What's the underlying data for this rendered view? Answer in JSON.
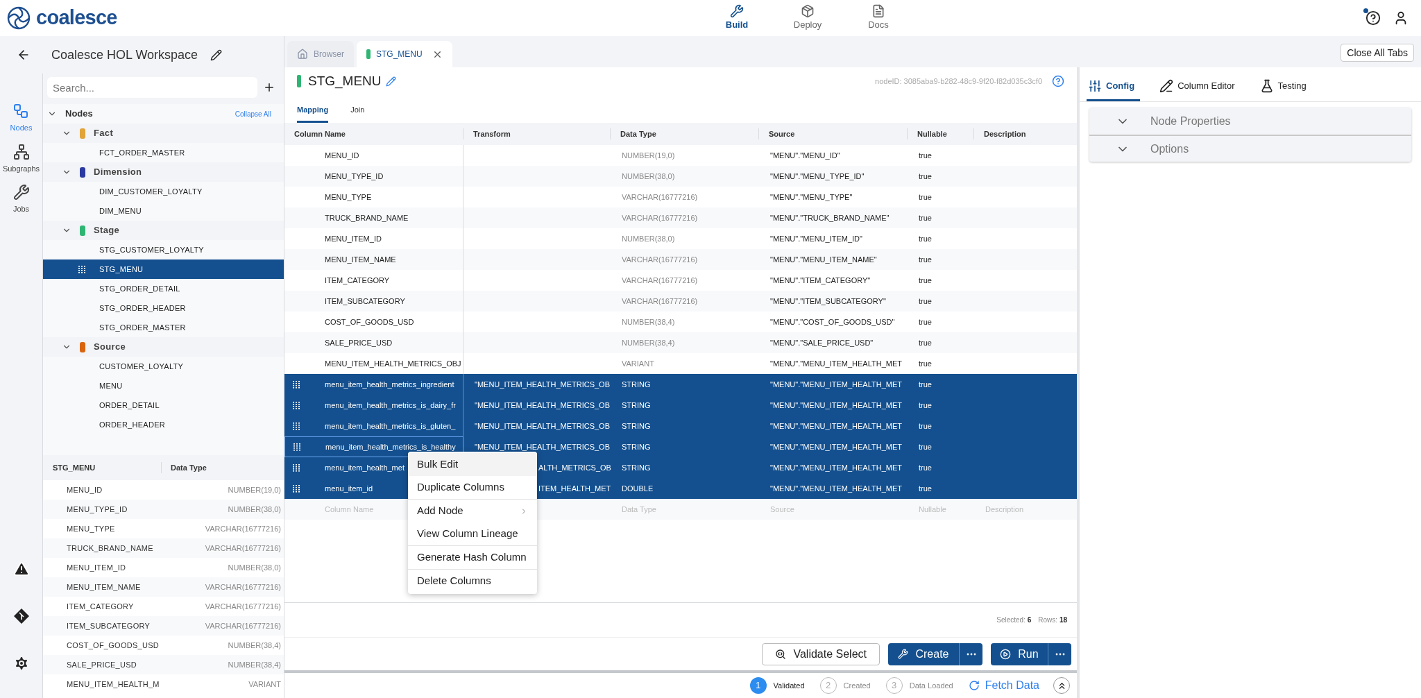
{
  "app": {
    "logo_text": "coalesce",
    "nav": [
      {
        "label": "Build",
        "kind": "build",
        "selected": true
      },
      {
        "label": "Deploy",
        "kind": "deploy",
        "selected": false
      },
      {
        "label": "Docs",
        "kind": "docs",
        "selected": false
      }
    ],
    "help_badge": true
  },
  "workspace": {
    "title": "Coalesce HOL Workspace"
  },
  "rail": [
    {
      "label": "Nodes",
      "kind": "nodes",
      "selected": true
    },
    {
      "label": "Subgraphs",
      "kind": "subgraphs",
      "selected": false
    },
    {
      "label": "Jobs",
      "kind": "jobs",
      "selected": false
    }
  ],
  "tree": {
    "search_placeholder": "Search...",
    "root": "Nodes",
    "root_expanded": true,
    "collapse_all": "Collapse All",
    "groups": [
      {
        "label": "Fact",
        "color": "#e0a43a",
        "expanded": true,
        "children": [
          {
            "label": "FCT_ORDER_MASTER",
            "selected": false
          }
        ]
      },
      {
        "label": "Dimension",
        "color": "#2b3aa0",
        "expanded": true,
        "children": [
          {
            "label": "DIM_CUSTOMER_LOYALTY",
            "selected": false
          },
          {
            "label": "DIM_MENU",
            "selected": false
          }
        ]
      },
      {
        "label": "Stage",
        "color": "#2fb573",
        "expanded": true,
        "children": [
          {
            "label": "STG_CUSTOMER_LOYALTY",
            "selected": false
          },
          {
            "label": "STG_MENU",
            "selected": true
          },
          {
            "label": "STG_ORDER_DETAIL",
            "selected": false
          },
          {
            "label": "STG_ORDER_HEADER",
            "selected": false
          },
          {
            "label": "STG_ORDER_MASTER",
            "selected": false
          }
        ]
      },
      {
        "label": "Source",
        "color": "#d9640f",
        "expanded": true,
        "children": [
          {
            "label": "CUSTOMER_LOYALTY",
            "selected": false
          },
          {
            "label": "MENU",
            "selected": false
          },
          {
            "label": "ORDER_DETAIL",
            "selected": false
          },
          {
            "label": "ORDER_HEADER",
            "selected": false
          }
        ]
      }
    ]
  },
  "column_list": {
    "columns": [
      "STG_MENU",
      "Data Type"
    ],
    "rows": [
      {
        "name": "MENU_ID",
        "type": "NUMBER(19,0)"
      },
      {
        "name": "MENU_TYPE_ID",
        "type": "NUMBER(38,0)"
      },
      {
        "name": "MENU_TYPE",
        "type": "VARCHAR(16777216)"
      },
      {
        "name": "TRUCK_BRAND_NAME",
        "type": "VARCHAR(16777216)"
      },
      {
        "name": "MENU_ITEM_ID",
        "type": "NUMBER(38,0)"
      },
      {
        "name": "MENU_ITEM_NAME",
        "type": "VARCHAR(16777216)"
      },
      {
        "name": "ITEM_CATEGORY",
        "type": "VARCHAR(16777216)"
      },
      {
        "name": "ITEM_SUBCATEGORY",
        "type": "VARCHAR(16777216)"
      },
      {
        "name": "COST_OF_GOODS_USD",
        "type": "NUMBER(38,4)"
      },
      {
        "name": "SALE_PRICE_USD",
        "type": "NUMBER(38,4)"
      },
      {
        "name": "MENU_ITEM_HEALTH_M",
        "type": "VARIANT"
      }
    ]
  },
  "tabs": [
    {
      "label": "Browser",
      "kind": "home",
      "selected": false
    },
    {
      "label": "STG_MENU",
      "kind": "node",
      "color": "#2fb573",
      "selected": true
    }
  ],
  "close_all": "Close All Tabs",
  "node": {
    "title": "STG_MENU",
    "color": "#2fb573",
    "node_id": "nodeID: 3085aba9-b282-48c9-9f20-f82d035c3cf0",
    "subtabs": [
      {
        "label": "Mapping",
        "selected": true
      },
      {
        "label": "Join",
        "selected": false
      }
    ],
    "table": {
      "columns": [
        "Column Name",
        "Transform",
        "Data Type",
        "Source",
        "Nullable",
        "Description"
      ],
      "rows": [
        {
          "name": "MENU_ID",
          "transform": "",
          "type": "NUMBER(19,0)",
          "source": "\"MENU\".\"MENU_ID\"",
          "nullable": "true",
          "selected": false,
          "focused": false
        },
        {
          "name": "MENU_TYPE_ID",
          "transform": "",
          "type": "NUMBER(38,0)",
          "source": "\"MENU\".\"MENU_TYPE_ID\"",
          "nullable": "true",
          "selected": false,
          "focused": false
        },
        {
          "name": "MENU_TYPE",
          "transform": "",
          "type": "VARCHAR(16777216)",
          "source": "\"MENU\".\"MENU_TYPE\"",
          "nullable": "true",
          "selected": false,
          "focused": false
        },
        {
          "name": "TRUCK_BRAND_NAME",
          "transform": "",
          "type": "VARCHAR(16777216)",
          "source": "\"MENU\".\"TRUCK_BRAND_NAME\"",
          "nullable": "true",
          "selected": false,
          "focused": false
        },
        {
          "name": "MENU_ITEM_ID",
          "transform": "",
          "type": "NUMBER(38,0)",
          "source": "\"MENU\".\"MENU_ITEM_ID\"",
          "nullable": "true",
          "selected": false,
          "focused": false
        },
        {
          "name": "MENU_ITEM_NAME",
          "transform": "",
          "type": "VARCHAR(16777216)",
          "source": "\"MENU\".\"MENU_ITEM_NAME\"",
          "nullable": "true",
          "selected": false,
          "focused": false
        },
        {
          "name": "ITEM_CATEGORY",
          "transform": "",
          "type": "VARCHAR(16777216)",
          "source": "\"MENU\".\"ITEM_CATEGORY\"",
          "nullable": "true",
          "selected": false,
          "focused": false
        },
        {
          "name": "ITEM_SUBCATEGORY",
          "transform": "",
          "type": "VARCHAR(16777216)",
          "source": "\"MENU\".\"ITEM_SUBCATEGORY\"",
          "nullable": "true",
          "selected": false,
          "focused": false
        },
        {
          "name": "COST_OF_GOODS_USD",
          "transform": "",
          "type": "NUMBER(38,4)",
          "source": "\"MENU\".\"COST_OF_GOODS_USD\"",
          "nullable": "true",
          "selected": false,
          "focused": false
        },
        {
          "name": "SALE_PRICE_USD",
          "transform": "",
          "type": "NUMBER(38,4)",
          "source": "\"MENU\".\"SALE_PRICE_USD\"",
          "nullable": "true",
          "selected": false,
          "focused": false
        },
        {
          "name": "MENU_ITEM_HEALTH_METRICS_OBJ",
          "transform": "",
          "type": "VARIANT",
          "source": "\"MENU\".\"MENU_ITEM_HEALTH_MET",
          "nullable": "true",
          "selected": false,
          "focused": false
        },
        {
          "name": "menu_item_health_metrics_ingredient",
          "transform": "\"MENU_ITEM_HEALTH_METRICS_OB",
          "type": "STRING",
          "source": "\"MENU\".\"MENU_ITEM_HEALTH_MET",
          "nullable": "true",
          "selected": true,
          "focused": false
        },
        {
          "name": "menu_item_health_metrics_is_dairy_fr",
          "transform": "\"MENU_ITEM_HEALTH_METRICS_OB",
          "type": "STRING",
          "source": "\"MENU\".\"MENU_ITEM_HEALTH_MET",
          "nullable": "true",
          "selected": true,
          "focused": false
        },
        {
          "name": "menu_item_health_metrics_is_gluten_",
          "transform": "\"MENU_ITEM_HEALTH_METRICS_OB",
          "type": "STRING",
          "source": "\"MENU\".\"MENU_ITEM_HEALTH_MET",
          "nullable": "true",
          "selected": true,
          "focused": false
        },
        {
          "name": "menu_item_health_metrics_is_healthy",
          "transform": "\"MENU_ITEM_HEALTH_METRICS_OB",
          "type": "STRING",
          "source": "\"MENU\".\"MENU_ITEM_HEALTH_MET",
          "nullable": "true",
          "selected": true,
          "focused": true
        },
        {
          "name": "menu_item_health_met",
          "transform": "ALTH_METRICS_OB",
          "type": "STRING",
          "source": "\"MENU\".\"MENU_ITEM_HEALTH_MET",
          "nullable": "true",
          "selected": true,
          "focused": false
        },
        {
          "name": "menu_item_id",
          "transform": "ITEM_HEALTH_MET",
          "type": "DOUBLE",
          "source": "\"MENU\".\"MENU_ITEM_HEALTH_MET",
          "nullable": "true",
          "selected": true,
          "focused": false
        }
      ],
      "new_row": {
        "name": "Column Name",
        "type": "Data Type",
        "source": "Source",
        "nullable": "Nullable",
        "description": "Description"
      }
    },
    "context_menu": [
      [
        {
          "label": "Bulk Edit",
          "highlighted": true,
          "submenu": false
        },
        {
          "label": "Duplicate Columns",
          "highlighted": false,
          "submenu": false
        }
      ],
      [
        {
          "label": "Add Node",
          "highlighted": false,
          "submenu": true
        },
        {
          "label": "View Column Lineage",
          "highlighted": false,
          "submenu": false
        }
      ],
      [
        {
          "label": "Generate Hash Column",
          "highlighted": false,
          "submenu": false
        }
      ],
      [
        {
          "label": "Delete Columns",
          "highlighted": false,
          "submenu": false
        }
      ]
    ],
    "footer": {
      "selected_label": "Selected:",
      "selected_count": "6",
      "rows_label": "Rows:",
      "rows_count": "18"
    },
    "actions": [
      {
        "label": "Validate Select",
        "kind": "outline"
      },
      {
        "label": "Create",
        "kind": "create"
      },
      {
        "label": "Run",
        "kind": "run"
      }
    ],
    "steps": [
      {
        "number": "1",
        "label": "Validated",
        "done": true
      },
      {
        "number": "2",
        "label": "Created",
        "done": false
      },
      {
        "number": "3",
        "label": "Data Loaded",
        "done": false
      }
    ],
    "fetch": "Fetch Data"
  },
  "right_panel": {
    "tabs": [
      {
        "label": "Config",
        "kind": "config",
        "selected": true
      },
      {
        "label": "Column Editor",
        "kind": "editor",
        "selected": false
      },
      {
        "label": "Testing",
        "kind": "testing",
        "selected": false
      }
    ],
    "sections": [
      "Node Properties",
      "Options"
    ]
  }
}
